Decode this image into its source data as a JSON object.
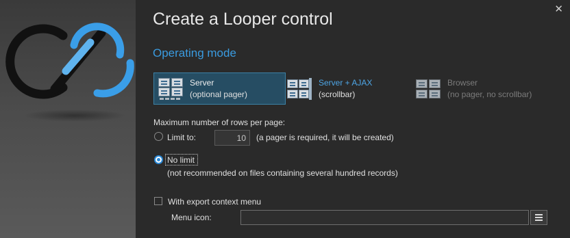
{
  "dialog": {
    "title": "Create a Looper control",
    "close_glyph": "✕"
  },
  "operating_mode": {
    "heading": "Operating mode",
    "options": [
      {
        "line1": "Server",
        "line2": "(optional pager)",
        "selected": true,
        "icon": "grid-pager-icon"
      },
      {
        "line1": "Server + AJAX",
        "line2": "(scrollbar)",
        "selected": false,
        "icon": "grid-scrollbar-icon"
      },
      {
        "line1": "Browser",
        "line2": "(no pager, no scrollbar)",
        "selected": false,
        "enabled": false,
        "icon": "grid-browser-icon"
      }
    ]
  },
  "rows": {
    "heading": "Maximum number of rows per page:",
    "limit_label": "Limit to:",
    "limit_value": "10",
    "limit_note": "(a pager is required, it will be created)",
    "no_limit_label": "No limit",
    "no_limit_note": "(not recommended on files containing several hundred records)",
    "selected": "no_limit"
  },
  "export": {
    "label": "With export context menu",
    "checked": false
  },
  "menu_icon": {
    "label": "Menu icon:",
    "value": ""
  },
  "colors": {
    "accent": "#3a9be0",
    "selection": "#264d63",
    "logo_blue": "#3a9ee8",
    "logo_black": "#111111"
  }
}
